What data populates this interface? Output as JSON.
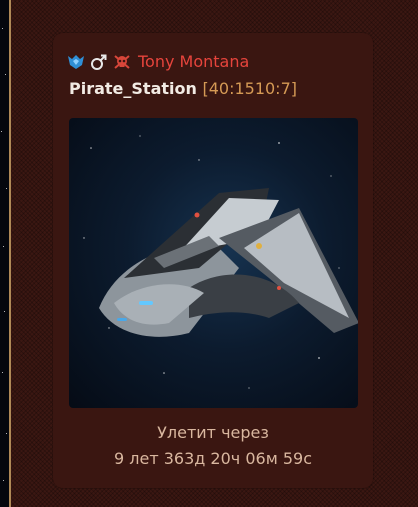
{
  "owner": {
    "name": "Tony Montana",
    "icons": [
      "alliance-crest-icon",
      "male-symbol-icon",
      "pirate-skull-icon"
    ],
    "name_color": "#e6443c"
  },
  "station": {
    "name": "Pirate_Station",
    "coords": "[40:1510:7]"
  },
  "ship_image": {
    "icon": "spaceship-image"
  },
  "departure": {
    "label": "Улетит через",
    "timer": "9 лет 363д 20ч 06м 59с"
  },
  "colors": {
    "panel_background": "#3b1712",
    "accent_gold": "#d59a55",
    "border_gold": "#b08a57"
  }
}
